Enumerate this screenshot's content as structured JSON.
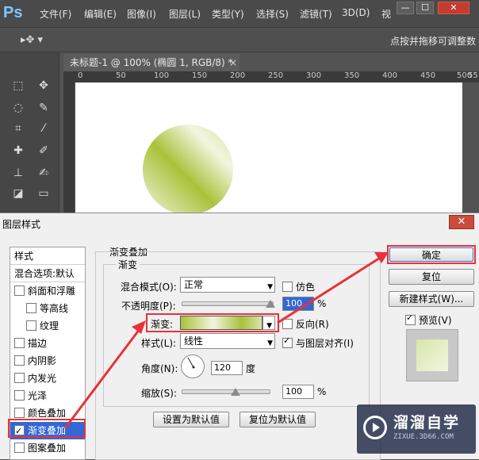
{
  "app": {
    "logo": "Ps",
    "menu": [
      "文件(F)",
      "编辑(E)",
      "图像(I)",
      "图层(L)",
      "类型(Y)",
      "选择(S)",
      "滤镜(T)",
      "3D(D)",
      "视"
    ],
    "window_controls": [
      "—",
      "☐",
      "✕"
    ],
    "hint": "点按并拖移可调整数",
    "document_tab": "未标题-1 @ 100% (椭圆 1, RGB/8) *",
    "tab_close": "×",
    "ruler_marks": [
      "0",
      "50",
      "100",
      "150",
      "200",
      "250",
      "300",
      "350",
      "400",
      "450",
      "500",
      "55"
    ],
    "colors": {
      "gradient_a": "#a9c23a",
      "gradient_b": "#f2f5de",
      "highlight": "#e8313a",
      "selected": "#3268d6"
    }
  },
  "dialog": {
    "title": "图层样式",
    "close": "✕",
    "styles_header": "样式",
    "blend_options": "混合选项:默认",
    "styles": [
      {
        "label": "斜面和浮雕",
        "checked": false,
        "indent": false,
        "selected": false
      },
      {
        "label": "等高线",
        "checked": false,
        "indent": true,
        "selected": false
      },
      {
        "label": "纹理",
        "checked": false,
        "indent": true,
        "selected": false
      },
      {
        "label": "描边",
        "checked": false,
        "indent": false,
        "selected": false
      },
      {
        "label": "内阴影",
        "checked": false,
        "indent": false,
        "selected": false
      },
      {
        "label": "内发光",
        "checked": false,
        "indent": false,
        "selected": false
      },
      {
        "label": "光泽",
        "checked": false,
        "indent": false,
        "selected": false
      },
      {
        "label": "颜色叠加",
        "checked": false,
        "indent": false,
        "selected": false
      },
      {
        "label": "渐变叠加",
        "checked": true,
        "indent": false,
        "selected": true
      },
      {
        "label": "图案叠加",
        "checked": false,
        "indent": false,
        "selected": false
      }
    ],
    "panel_title": "渐变叠加",
    "group_title": "渐变",
    "blend_mode": {
      "label": "混合模式(O):",
      "value": "正常"
    },
    "dither": {
      "label": "仿色",
      "checked": false
    },
    "opacity": {
      "label": "不透明度(P):",
      "value": "100",
      "unit": "%"
    },
    "gradient": {
      "label": "渐变:"
    },
    "reverse": {
      "label": "反向(R)",
      "checked": false
    },
    "style": {
      "label": "样式(L):",
      "value": "线性"
    },
    "align": {
      "label": "与图层对齐(I)",
      "checked": true
    },
    "angle": {
      "label": "角度(N):",
      "value": "120",
      "unit": "度"
    },
    "scale": {
      "label": "缩放(S):",
      "value": "100",
      "unit": "%"
    },
    "set_default": "设置为默认值",
    "reset_default": "复位为默认值",
    "ok": "确定",
    "reset": "复位",
    "new_style": "新建样式(W)...",
    "preview": {
      "label": "预览(V)",
      "checked": true
    }
  },
  "watermark": {
    "title": "溜溜自学",
    "url": "ZIXUE.3D66.COM"
  }
}
